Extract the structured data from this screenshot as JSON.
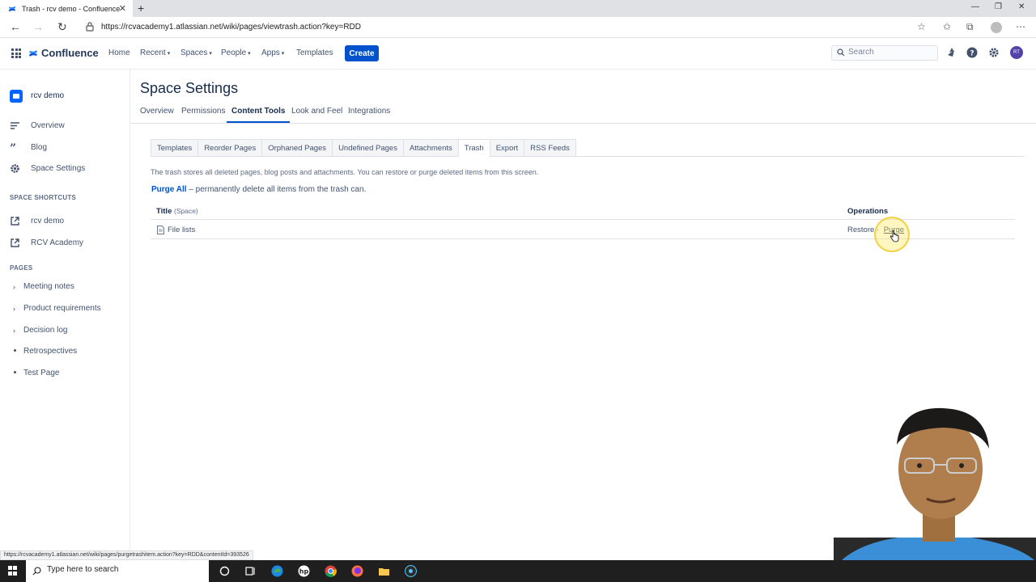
{
  "browser": {
    "tab_title": "Trash - rcv demo - Confluence",
    "new_tab": "+",
    "close_tab": "✕",
    "url": "https://rcvacademy1.atlassian.net/wiki/pages/viewtrash.action?key=RDD",
    "status_url": "https://rcvacademy1.atlassian.net/wiki/pages/purgetrashitem.action?key=RDD&contentId=393526",
    "window_controls": [
      "—",
      "❐",
      "✕"
    ]
  },
  "topnav": {
    "brand": "Confluence",
    "items": [
      {
        "label": "Home",
        "dropdown": false
      },
      {
        "label": "Recent",
        "dropdown": true
      },
      {
        "label": "Spaces",
        "dropdown": true
      },
      {
        "label": "People",
        "dropdown": true
      },
      {
        "label": "Apps",
        "dropdown": true
      },
      {
        "label": "Templates",
        "dropdown": false
      }
    ],
    "create_label": "Create",
    "search_placeholder": "Search",
    "avatar_initials": "RT",
    "accent": "#0052CC"
  },
  "sidebar": {
    "space_name": "rcv demo",
    "items": [
      {
        "label": "Overview",
        "icon": "overview-icon"
      },
      {
        "label": "Blog",
        "icon": "quote-icon"
      },
      {
        "label": "Space Settings",
        "icon": "gear-icon"
      }
    ],
    "shortcuts_heading": "SPACE SHORTCUTS",
    "shortcuts": [
      {
        "label": "rcv demo",
        "icon": "external-link-icon"
      },
      {
        "label": "RCV Academy",
        "icon": "external-link-icon"
      }
    ],
    "pages_heading": "PAGES",
    "pages": [
      {
        "label": "Meeting notes",
        "expandable": true
      },
      {
        "label": "Product requirements",
        "expandable": true
      },
      {
        "label": "Decision log",
        "expandable": true
      },
      {
        "label": "Retrospectives",
        "expandable": false
      },
      {
        "label": "Test Page",
        "expandable": false
      }
    ]
  },
  "main": {
    "title": "Space Settings",
    "settings_tabs": [
      {
        "label": "Overview",
        "active": false
      },
      {
        "label": "Permissions",
        "active": false
      },
      {
        "label": "Content Tools",
        "active": true
      },
      {
        "label": "Look and Feel",
        "active": false
      },
      {
        "label": "Integrations",
        "active": false
      }
    ],
    "content_tabs": [
      {
        "label": "Templates",
        "active": false
      },
      {
        "label": "Reorder Pages",
        "active": false
      },
      {
        "label": "Orphaned Pages",
        "active": false
      },
      {
        "label": "Undefined Pages",
        "active": false
      },
      {
        "label": "Attachments",
        "active": false
      },
      {
        "label": "Trash",
        "active": true
      },
      {
        "label": "Export",
        "active": false
      },
      {
        "label": "RSS Feeds",
        "active": false
      }
    ],
    "description": "The trash stores all deleted pages, blog posts and attachments. You can restore or purge deleted items from this screen.",
    "purge_all_link": "Purge All",
    "purge_all_text": " – permanently delete all items from the trash can.",
    "table": {
      "col_title": "Title",
      "col_title_sub": "(Space)",
      "col_ops": "Operations",
      "rows": [
        {
          "title": "File lists",
          "restore": "Restore",
          "separator": "·",
          "purge": "Purge"
        }
      ]
    }
  },
  "taskbar": {
    "search_placeholder": "Type here to search"
  }
}
